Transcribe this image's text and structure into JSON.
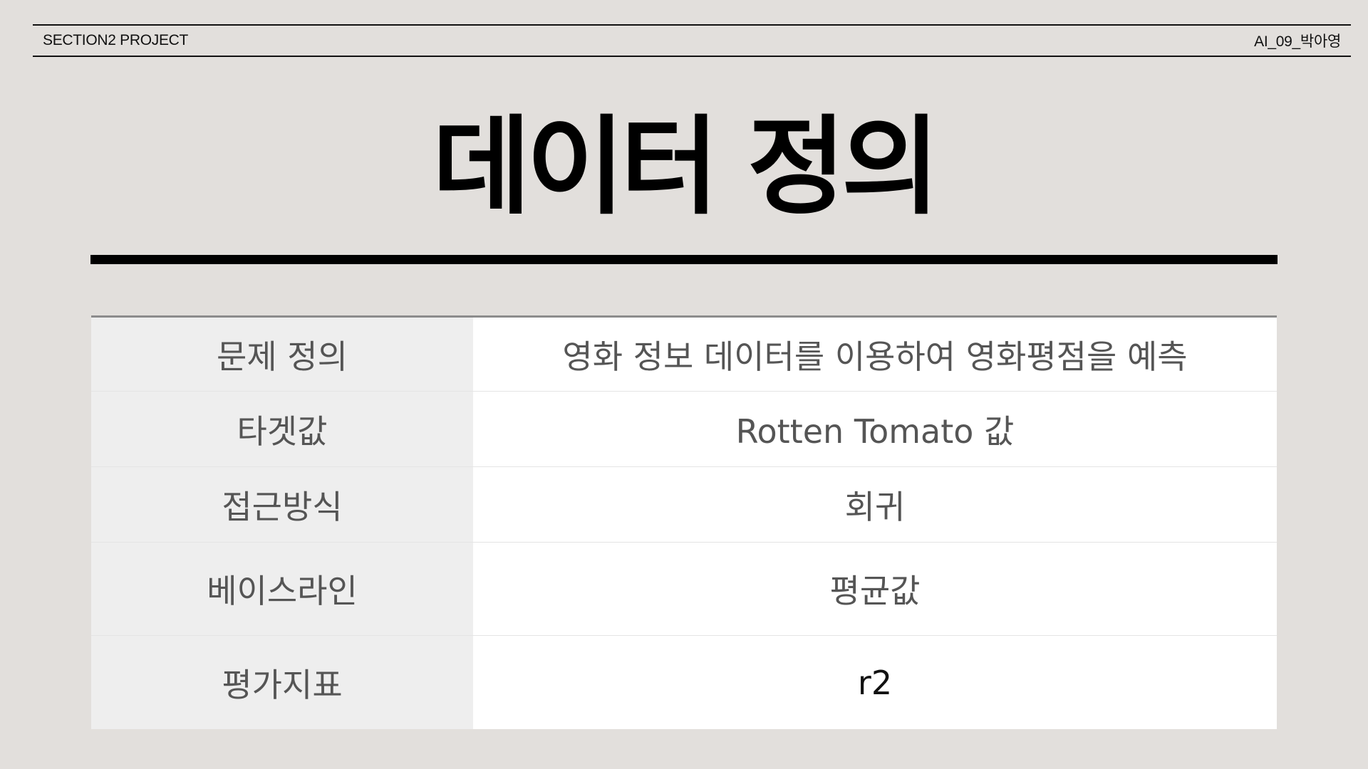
{
  "header": {
    "left_text": "SECTION2 PROJECT",
    "right_text": "AI_09_박아영"
  },
  "title": "데이터 정의",
  "table": {
    "rows": [
      {
        "label": "문제 정의",
        "value": "영화 정보 데이터를 이용하여 영화평점을 예측"
      },
      {
        "label": "타겟값",
        "value": "Rotten Tomato 값"
      },
      {
        "label": "접근방식",
        "value": "회귀"
      },
      {
        "label": "베이스라인",
        "value": "평균값"
      },
      {
        "label": "평가지표",
        "value": "r2"
      }
    ]
  },
  "colors": {
    "background": "#e2dfdc",
    "label_cell": "#eeeeee",
    "value_cell": "#ffffff",
    "text": "#555555",
    "rule": "#000000"
  }
}
